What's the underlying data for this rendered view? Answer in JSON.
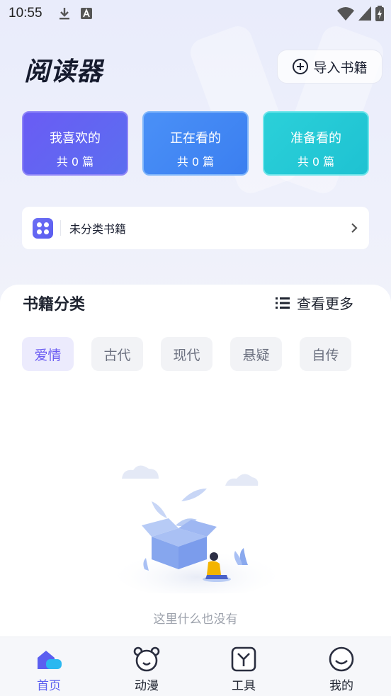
{
  "status": {
    "time": "10:55"
  },
  "header": {
    "title": "阅读器",
    "import_label": "导入书籍"
  },
  "cards": [
    {
      "title": "我喜欢的",
      "count": "共 0 篇"
    },
    {
      "title": "正在看的",
      "count": "共 0 篇"
    },
    {
      "title": "准备看的",
      "count": "共 0 篇"
    }
  ],
  "uncategorized": {
    "label": "未分类书籍"
  },
  "categories": {
    "title": "书籍分类",
    "more_label": "查看更多",
    "tags": [
      "爱情",
      "古代",
      "现代",
      "悬疑",
      "自传"
    ],
    "active_tag": "爱情"
  },
  "empty": {
    "message": "这里什么也没有"
  },
  "tabbar": {
    "items": [
      {
        "label": "首页",
        "icon": "home-icon"
      },
      {
        "label": "动漫",
        "icon": "bear-face-icon"
      },
      {
        "label": "工具",
        "icon": "tools-box-icon"
      },
      {
        "label": "我的",
        "icon": "smile-face-icon"
      }
    ],
    "active": "首页"
  },
  "colors": {
    "accent": "#5b5ff0",
    "card_favorite": "#6a5cf4",
    "card_reading": "#4a90f7",
    "card_planned": "#2bd0d9"
  }
}
